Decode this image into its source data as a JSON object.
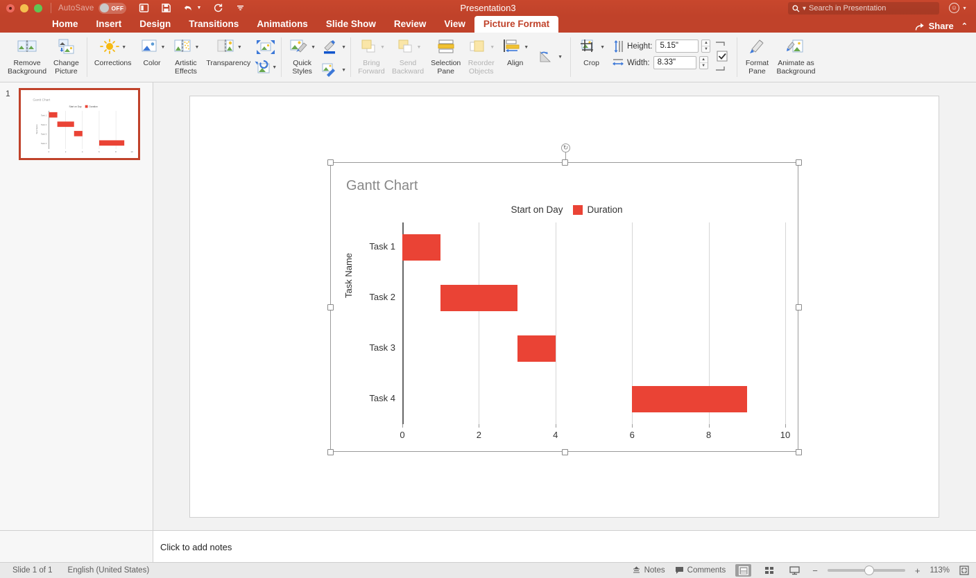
{
  "titlebar": {
    "autosave_label": "AutoSave",
    "autosave_state": "OFF",
    "window_title": "Presentation3",
    "icons": [
      "new-slide-icon",
      "save-icon",
      "undo-icon",
      "redo-icon",
      "customize-toolbar-icon"
    ]
  },
  "search": {
    "placeholder": "Search in Presentation",
    "icon": "search-icon"
  },
  "account": {
    "icon": "smiley-face-icon"
  },
  "share": {
    "label": "Share",
    "icon": "share-icon",
    "collapse_icon": "chevron-up-icon"
  },
  "tabs": [
    {
      "label": "Home",
      "active": false
    },
    {
      "label": "Insert",
      "active": false
    },
    {
      "label": "Design",
      "active": false
    },
    {
      "label": "Transitions",
      "active": false
    },
    {
      "label": "Animations",
      "active": false
    },
    {
      "label": "Slide Show",
      "active": false
    },
    {
      "label": "Review",
      "active": false
    },
    {
      "label": "View",
      "active": false
    },
    {
      "label": "Picture Format",
      "active": true
    }
  ],
  "ribbon": {
    "groups": [
      {
        "name": "adjust-left",
        "items": [
          {
            "label": "Remove\nBackground",
            "icon": "remove-background-icon",
            "disabled": false,
            "has_caret": false
          },
          {
            "label": "Change\nPicture",
            "icon": "change-picture-icon",
            "disabled": false,
            "has_caret": false
          }
        ]
      },
      {
        "name": "adjust",
        "items": [
          {
            "label": "Corrections",
            "icon": "corrections-sun-icon",
            "disabled": false,
            "has_caret": true
          },
          {
            "label": "Color",
            "icon": "color-picture-icon",
            "disabled": false,
            "has_caret": true
          },
          {
            "label": "Artistic\nEffects",
            "icon": "artistic-effects-icon",
            "disabled": false,
            "has_caret": true
          },
          {
            "label": "Transparency",
            "icon": "transparency-icon",
            "disabled": false,
            "has_caret": true
          },
          {
            "label": "",
            "icon": "compress-picture-icon",
            "disabled": false,
            "has_caret": false
          },
          {
            "label": "",
            "icon": "reset-picture-icon",
            "disabled": false,
            "has_caret": true
          }
        ]
      },
      {
        "name": "picture-styles",
        "items": [
          {
            "label": "Quick\nStyles",
            "icon": "quick-styles-icon",
            "disabled": false,
            "has_caret": true
          },
          {
            "label": "",
            "icon": "picture-border-icon",
            "disabled": false,
            "has_caret": true
          },
          {
            "label": "",
            "icon": "picture-effects-icon",
            "disabled": false,
            "has_caret": true
          }
        ]
      },
      {
        "name": "arrange",
        "items": [
          {
            "label": "Bring\nForward",
            "icon": "bring-forward-icon",
            "disabled": true,
            "has_caret": true
          },
          {
            "label": "Send\nBackward",
            "icon": "send-backward-icon",
            "disabled": true,
            "has_caret": true
          },
          {
            "label": "Selection\nPane",
            "icon": "selection-pane-icon",
            "disabled": false,
            "has_caret": false
          },
          {
            "label": "Reorder\nObjects",
            "icon": "reorder-objects-icon",
            "disabled": true,
            "has_caret": true
          },
          {
            "label": "Align",
            "icon": "align-icon",
            "disabled": false,
            "has_caret": true
          },
          {
            "label": "",
            "icon": "rotate-icon",
            "disabled": false,
            "has_caret": true
          }
        ]
      },
      {
        "name": "size",
        "items": [
          {
            "label": "Crop",
            "icon": "crop-icon",
            "disabled": false,
            "has_caret": true
          }
        ]
      }
    ],
    "size": {
      "height_label": "Height:",
      "height_value": "5.15\"",
      "width_label": "Width:",
      "width_value": "8.33\"",
      "lock_aspect_checked": true
    },
    "right_items": [
      {
        "label": "Format\nPane",
        "icon": "format-pane-icon"
      },
      {
        "label": "Animate as\nBackground",
        "icon": "animate-as-background-icon"
      }
    ]
  },
  "thumbnails": [
    {
      "number": "1",
      "selected": true
    }
  ],
  "notes": {
    "placeholder": "Click to add notes"
  },
  "statusbar": {
    "slide_count": "Slide 1 of 1",
    "language": "English (United States)",
    "notes_label": "Notes",
    "notes_icon": "notes-icon",
    "comments_label": "Comments",
    "comments_icon": "comment-bubble-icon",
    "view_normal_icon": "normal-view-icon",
    "view_sorter_icon": "slide-sorter-icon",
    "view_slideshow_icon": "slideshow-view-icon",
    "zoom_out_icon": "minus-icon",
    "zoom_in_icon": "plus-icon",
    "zoom_level": "113%",
    "fit_icon": "fit-to-window-icon"
  },
  "selection": {
    "rotate_handle_icon": "rotate-handle-icon",
    "handles": 8
  },
  "chart_data": {
    "type": "bar",
    "orientation": "horizontal",
    "subtype": "stacked-gantt",
    "title": "Gantt Chart",
    "xlabel": "",
    "ylabel": "Task Name",
    "categories": [
      "Task 1",
      "Task 2",
      "Task 3",
      "Task 4"
    ],
    "series": [
      {
        "name": "Start on Day",
        "values": [
          0,
          1,
          3,
          6
        ],
        "color": "#ffffff",
        "visible_in_plot": false
      },
      {
        "name": "Duration",
        "values": [
          1,
          2,
          1,
          3
        ],
        "color": "#ea4335",
        "visible_in_plot": true
      }
    ],
    "xlim": [
      0,
      10
    ],
    "xticks": [
      0,
      2,
      4,
      6,
      8,
      10
    ],
    "xtick_labels": [
      "0",
      "2",
      "4",
      "6",
      "8",
      "10"
    ],
    "grid": true,
    "grid_axis": "x",
    "legend_position": "top",
    "title_color": "#888888",
    "bar_color": "#ea4335"
  }
}
